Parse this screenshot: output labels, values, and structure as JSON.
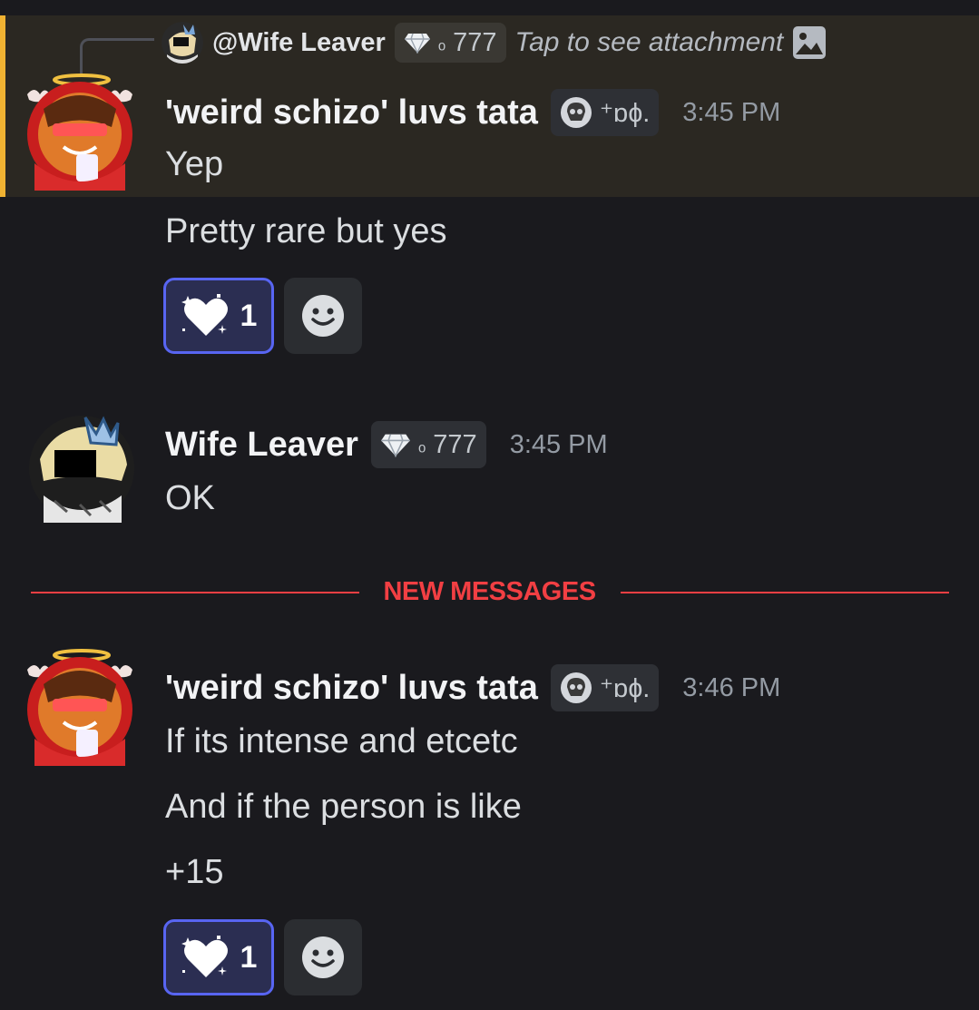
{
  "reply": {
    "mention": "@Wife Leaver",
    "tag_value": "777",
    "attachment_text": "Tap to see attachment"
  },
  "message1": {
    "username": "'weird schizo' luvs tata",
    "tag_text": "⁺ɒɸ.",
    "timestamp": "3:45 PM",
    "lines": [
      "Yep",
      "Pretty rare but yes"
    ],
    "reaction_count": "1"
  },
  "message2": {
    "username": "Wife Leaver",
    "tag_value": "777",
    "timestamp": "3:45 PM",
    "lines": [
      "OK"
    ]
  },
  "divider": {
    "label": "NEW MESSAGES"
  },
  "message3": {
    "username": "'weird schizo' luvs tata",
    "tag_text": "⁺ɒɸ.",
    "timestamp": "3:46 PM",
    "lines": [
      "If its intense and etcetc",
      "And if the person is like",
      "+15"
    ],
    "reaction_count": "1"
  },
  "icons": {
    "tag_gem": "diamond-icon",
    "tag_skull": "skull-icon",
    "attachment": "image-icon",
    "reaction_emoji": "sparkle-heart-icon",
    "add_reaction": "smiley-icon"
  },
  "colors": {
    "background": "#1a1a1e",
    "mention_highlight": "#2b2822",
    "mention_bar": "#f0b232",
    "new_messages": "#f23f43",
    "reaction_active_border": "#5865f2"
  }
}
